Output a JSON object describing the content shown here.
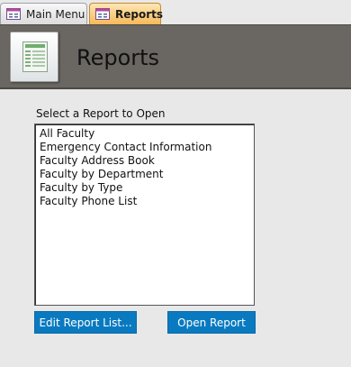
{
  "tabs": [
    {
      "label": "Main Menu",
      "icon": "form-icon",
      "active": false
    },
    {
      "label": "Reports",
      "icon": "form-icon",
      "active": true
    }
  ],
  "header": {
    "title": "Reports",
    "logo_icon": "report-list-icon"
  },
  "form": {
    "prompt": "Select a Report to Open",
    "reports": [
      "All Faculty",
      "Emergency Contact Information",
      "Faculty Address Book",
      "Faculty by Department",
      "Faculty by Type",
      "Faculty Phone List"
    ],
    "edit_button": "Edit Report List...",
    "open_button": "Open Report"
  },
  "colors": {
    "header_bg": "#6a6661",
    "active_tab": "#f7b95a",
    "button_bg": "#0a7ac0",
    "body_bg": "#e8e8e8"
  }
}
